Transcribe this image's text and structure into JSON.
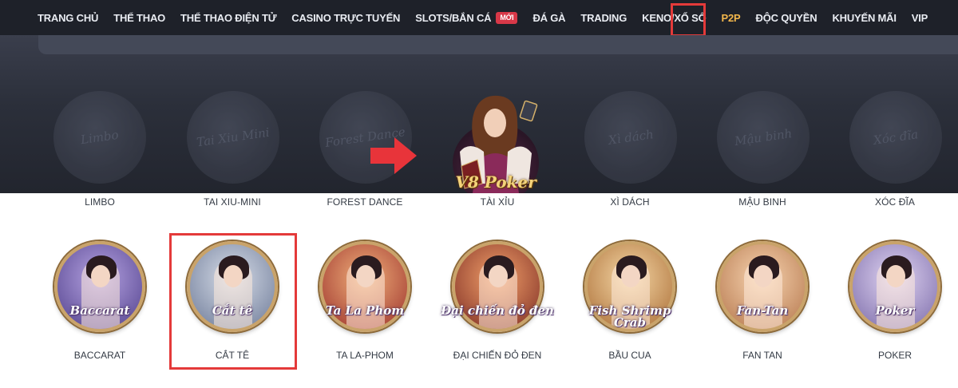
{
  "nav": {
    "items": [
      {
        "label": "TRANG CHỦ"
      },
      {
        "label": "THỂ THAO"
      },
      {
        "label": "THỂ THAO ĐIỆN TỬ"
      },
      {
        "label": "CASINO TRỰC TUYẾN"
      },
      {
        "label": "SLOTS/BẮN CÁ",
        "badge": "MỚI"
      },
      {
        "label": "ĐÁ GÀ"
      },
      {
        "label": "TRADING"
      },
      {
        "label": "KENO/XỔ SỐ"
      },
      {
        "label": "P2P",
        "active": true
      },
      {
        "label": "ĐỘC QUYỀN"
      },
      {
        "label": "KHUYẾN MÃI"
      },
      {
        "label": "VIP"
      }
    ],
    "active_color": "#f2b64b",
    "highlight_color": "#e43a3a"
  },
  "panel": {
    "ghost_titles": [
      "Limbo",
      "Tai Xiu Mini",
      "Forest Dance",
      "",
      "Xì dách",
      "Mậu binh",
      "Xóc đĩa"
    ],
    "hero_title": "V8 Poker",
    "arrow_icon": "arrow-right-icon"
  },
  "row1_labels": [
    "LIMBO",
    "TAI XIU-MINI",
    "FOREST DANCE",
    "TÀI XỈU",
    "XÌ DÁCH",
    "MẬU BINH",
    "XÓC ĐĨA"
  ],
  "games": [
    {
      "name": "BACCARAT",
      "art_title": "Baccarat",
      "tint": "#6a5bb0"
    },
    {
      "name": "CẮT TÊ",
      "art_title": "Cắt tê",
      "tint": "#8d9ab8"
    },
    {
      "name": "TA LA-PHOM",
      "art_title": "Ta La Phom",
      "tint": "#b0443a"
    },
    {
      "name": "ĐẠI CHIẾN ĐỎ ĐEN",
      "art_title": "Đại chiến đỏ đen",
      "tint": "#9a4a3a"
    },
    {
      "name": "BẦU CUA",
      "art_title": "Fish Shrimp Crab",
      "tint": "#c9924a"
    },
    {
      "name": "FAN TAN",
      "art_title": "Fan-Tan",
      "tint": "#c5905a"
    },
    {
      "name": "POKER",
      "art_title": "Poker",
      "tint": "#9a8bc0"
    }
  ]
}
